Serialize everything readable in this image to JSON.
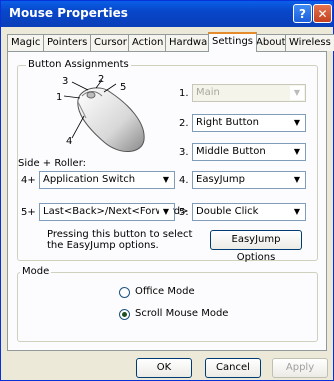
{
  "window": {
    "title": "Mouse Properties",
    "help_label": "?",
    "close_label": "✕"
  },
  "tabs": [
    "Magic",
    "Pointers",
    "Cursor",
    "Action",
    "Hardware",
    "Settings",
    "About",
    "Wireless"
  ],
  "active_tab": "Settings",
  "button_assignments": {
    "legend": "Button  Assignments",
    "callouts": [
      "3",
      "2",
      "5",
      "1",
      "4"
    ],
    "rows": [
      {
        "num": "1.",
        "value": "Main",
        "disabled": true
      },
      {
        "num": "2.",
        "value": "Right Button"
      },
      {
        "num": "3.",
        "value": "Middle Button"
      }
    ],
    "side_roller_label": "Side + Roller:",
    "side": [
      {
        "prefix": "4+",
        "value": "Application Switch",
        "num": "4.",
        "value2": "EasyJump"
      },
      {
        "prefix": "5+",
        "value": "Last<Back>/Next<Forward>",
        "num": "5.",
        "value2": "Double Click"
      }
    ],
    "easyjump_text": "Pressing this button to select the EasyJump options.",
    "easyjump_button": "EasyJump Options"
  },
  "mode": {
    "legend": "Mode",
    "options": [
      {
        "label": "Office Mode",
        "selected": false
      },
      {
        "label": "Scroll Mouse Mode",
        "selected": true
      }
    ]
  },
  "footer": {
    "ok": "OK",
    "cancel": "Cancel",
    "apply": "Apply"
  }
}
